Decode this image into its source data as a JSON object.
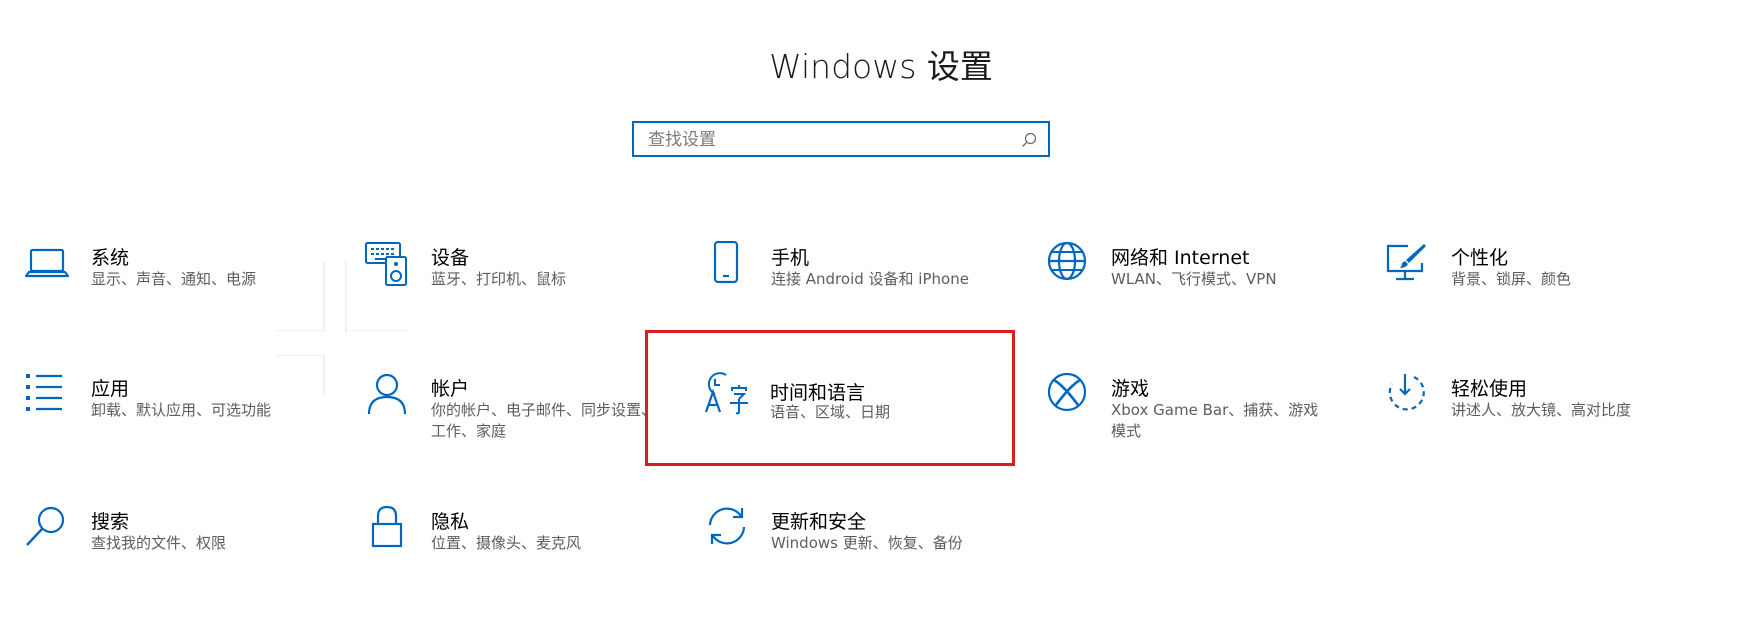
{
  "window": {
    "title": "Windows 设置"
  },
  "search": {
    "placeholder": "查找设置"
  },
  "accent": "#0067c0",
  "selection_color": "#d81e1e",
  "tiles": [
    {
      "name": "系统",
      "desc": "显示、声音、通知、电源",
      "icon": "laptop-icon"
    },
    {
      "name": "设备",
      "desc": "蓝牙、打印机、鼠标",
      "icon": "keyboard-speaker-icon"
    },
    {
      "name": "手机",
      "desc": "连接 Android 设备和 iPhone",
      "icon": "phone-icon"
    },
    {
      "name": "网络和 Internet",
      "desc": "WLAN、飞行模式、VPN",
      "icon": "globe-icon"
    },
    {
      "name": "个性化",
      "desc": "背景、锁屏、颜色",
      "icon": "paint-screen-icon"
    },
    {
      "name": "应用",
      "desc": "卸载、默认应用、可选功能",
      "icon": "apps-list-icon"
    },
    {
      "name": "帐户",
      "desc": "你的帐户、电子邮件、同步设置、工作、家庭",
      "icon": "person-icon"
    },
    {
      "name": "时间和语言",
      "desc": "语音、区域、日期",
      "icon": "time-language-icon",
      "selected": true
    },
    {
      "name": "游戏",
      "desc": "Xbox Game Bar、捕获、游戏模式",
      "icon": "xbox-icon"
    },
    {
      "name": "轻松使用",
      "desc": "讲述人、放大镜、高对比度",
      "icon": "ease-of-access-icon"
    },
    {
      "name": "搜索",
      "desc": "查找我的文件、权限",
      "icon": "search-icon"
    },
    {
      "name": "隐私",
      "desc": "位置、摄像头、麦克风",
      "icon": "lock-icon"
    },
    {
      "name": "更新和安全",
      "desc": "Windows 更新、恢复、备份",
      "icon": "sync-icon"
    }
  ]
}
